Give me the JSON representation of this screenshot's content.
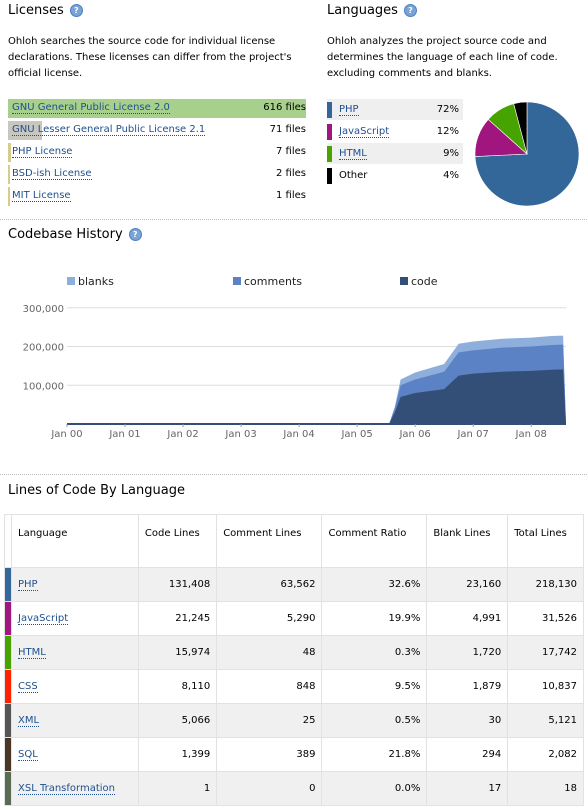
{
  "licenses": {
    "title": "Licenses",
    "description": "Ohloh searches the source code for individual license declarations. These licenses can differ from the project's official license.",
    "items": [
      {
        "name": "GNU General Public License 2.0",
        "count": "616 files",
        "fraction": 1.0,
        "color": "#a8d08d"
      },
      {
        "name": "GNU Lesser General Public License 2.1",
        "count": "71 files",
        "fraction": 0.115,
        "color": "#c7c7bf"
      },
      {
        "name": "PHP License",
        "count": "7 files",
        "fraction": 0.011,
        "color": "#d8cc8a"
      },
      {
        "name": "BSD-ish License",
        "count": "2 files",
        "fraction": 0.003,
        "color": "#d8cc8a"
      },
      {
        "name": "MIT License",
        "count": "1 files",
        "fraction": 0.002,
        "color": "#d8cc8a"
      }
    ]
  },
  "languages": {
    "title": "Languages",
    "description": "Ohloh analyzes the project source code and determines the language of each line of code. excluding comments and blanks.",
    "items": [
      {
        "name": "PHP",
        "percent": "72%",
        "color": "#336699",
        "link": true
      },
      {
        "name": "JavaScript",
        "percent": "12%",
        "color": "#a0157e",
        "link": true
      },
      {
        "name": "HTML",
        "percent": "9%",
        "color": "#47a400",
        "link": true
      },
      {
        "name": "Other",
        "percent": "4%",
        "color": "#000000",
        "link": false
      }
    ],
    "pie": [
      {
        "label": "PHP",
        "value": 72,
        "color": "#336699"
      },
      {
        "label": "JavaScript",
        "value": 12,
        "color": "#a0157e"
      },
      {
        "label": "HTML",
        "value": 9,
        "color": "#47a400"
      },
      {
        "label": "Other",
        "value": 4,
        "color": "#000000"
      }
    ]
  },
  "history": {
    "title": "Codebase History",
    "chart_data": {
      "type": "area",
      "legend": [
        "blanks",
        "comments",
        "code"
      ],
      "colors": {
        "blanks": "#8eaedb",
        "comments": "#5b82c4",
        "code": "#334f78"
      },
      "x": [
        "Jan 00",
        "Jan 01",
        "Jan 02",
        "Jan 03",
        "Jan 04",
        "Jan 05",
        "Jan 06",
        "Jan 07",
        "Jan 08"
      ],
      "yticks": [
        "100,000",
        "200,000",
        "300,000"
      ],
      "ylim": [
        0,
        320000
      ],
      "series_points": [
        {
          "t": 0.0,
          "code": 0,
          "comments": 0,
          "blanks": 0
        },
        {
          "t": 5.55,
          "code": 0,
          "comments": 0,
          "blanks": 0
        },
        {
          "t": 5.65,
          "code": 30000,
          "comments": 10000,
          "blanks": 5000
        },
        {
          "t": 5.75,
          "code": 70000,
          "comments": 30000,
          "blanks": 15000
        },
        {
          "t": 6.0,
          "code": 80000,
          "comments": 35000,
          "blanks": 18000
        },
        {
          "t": 6.5,
          "code": 90000,
          "comments": 45000,
          "blanks": 20000
        },
        {
          "t": 6.75,
          "code": 125000,
          "comments": 60000,
          "blanks": 22000
        },
        {
          "t": 7.0,
          "code": 130000,
          "comments": 60000,
          "blanks": 23000
        },
        {
          "t": 7.5,
          "code": 135000,
          "comments": 62000,
          "blanks": 23000
        },
        {
          "t": 8.0,
          "code": 137000,
          "comments": 63000,
          "blanks": 23000
        },
        {
          "t": 8.35,
          "code": 140000,
          "comments": 64000,
          "blanks": 23000
        },
        {
          "t": 8.55,
          "code": 141000,
          "comments": 64000,
          "blanks": 23000
        },
        {
          "t": 8.6,
          "code": 0,
          "comments": 0,
          "blanks": 0
        }
      ]
    }
  },
  "loc": {
    "title": "Lines of Code By Language",
    "headers": [
      "Language",
      "Code Lines",
      "Comment Lines",
      "Comment Ratio",
      "Blank Lines",
      "Total Lines"
    ],
    "rows": [
      {
        "lang": "PHP",
        "color": "#336699",
        "code": "131,408",
        "comments": "63,562",
        "ratio": "32.6%",
        "blank": "23,160",
        "total": "218,130"
      },
      {
        "lang": "JavaScript",
        "color": "#a0157e",
        "code": "21,245",
        "comments": "5,290",
        "ratio": "19.9%",
        "blank": "4,991",
        "total": "31,526"
      },
      {
        "lang": "HTML",
        "color": "#47a400",
        "code": "15,974",
        "comments": "48",
        "ratio": "0.3%",
        "blank": "1,720",
        "total": "17,742"
      },
      {
        "lang": "CSS",
        "color": "#ff2200",
        "code": "8,110",
        "comments": "848",
        "ratio": "9.5%",
        "blank": "1,879",
        "total": "10,837"
      },
      {
        "lang": "XML",
        "color": "#555555",
        "code": "5,066",
        "comments": "25",
        "ratio": "0.5%",
        "blank": "30",
        "total": "5,121"
      },
      {
        "lang": "SQL",
        "color": "#493625",
        "code": "1,399",
        "comments": "389",
        "ratio": "21.8%",
        "blank": "294",
        "total": "2,082"
      },
      {
        "lang": "XSL Transformation",
        "color": "#5a6b55",
        "code": "1",
        "comments": "0",
        "ratio": "0.0%",
        "blank": "17",
        "total": "18"
      }
    ]
  }
}
